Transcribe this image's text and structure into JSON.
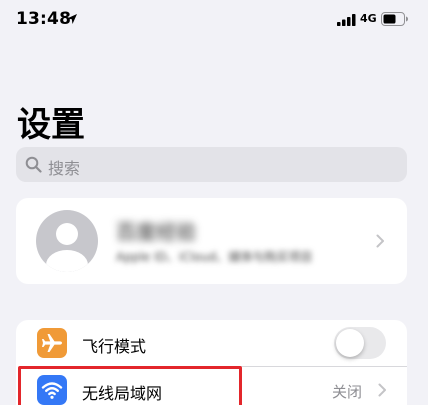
{
  "status_bar": {
    "time": "13:48",
    "network": "4G",
    "icons": [
      "location-arrow-icon",
      "signal-icon",
      "battery-icon"
    ]
  },
  "page": {
    "title": "设置"
  },
  "search": {
    "placeholder": "搜索"
  },
  "profile": {
    "name": "百度经验",
    "subtitle": "Apple ID、iCloud、媒体与购买项目"
  },
  "settings": [
    {
      "label": "飞行模式",
      "icon": "airplane-icon",
      "icon_color": "#f09a37",
      "toggle_on": false
    },
    {
      "label": "无线局域网",
      "icon": "wifi-icon",
      "icon_color": "#3478f6",
      "value": "关闭"
    }
  ],
  "colors": {
    "background": "#f2f2f7",
    "highlight": "#e3262b"
  }
}
